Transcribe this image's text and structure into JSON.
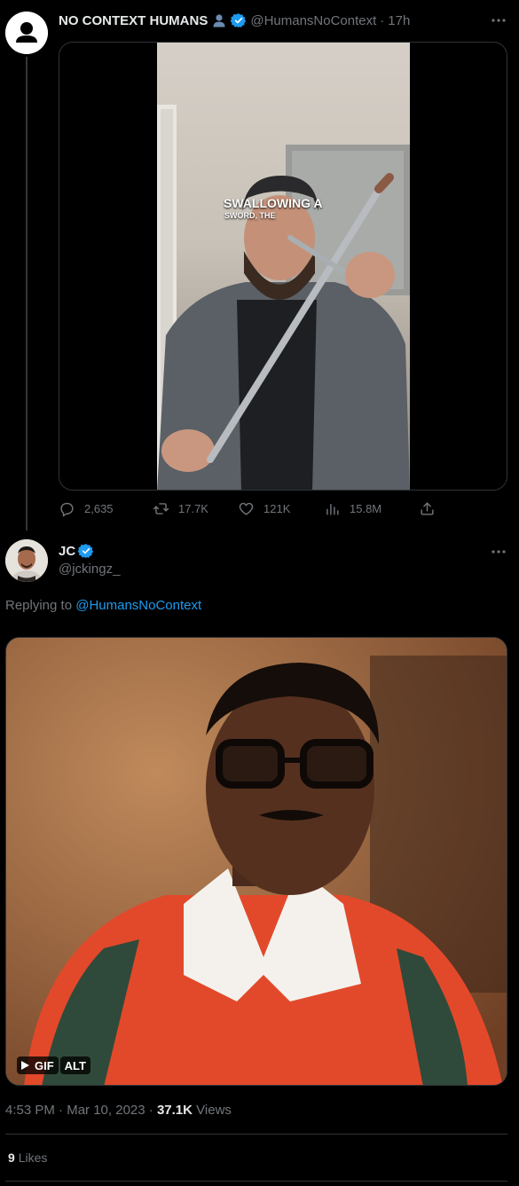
{
  "original_tweet": {
    "author_name": "NO CONTEXT HUMANS",
    "handle": "@HumansNoContext",
    "time": "17h",
    "media_caption_line1": "SWALLOWING A",
    "media_caption_line2": "SWORD, THE",
    "stats": {
      "replies": "2,635",
      "retweets": "17.7K",
      "likes": "121K",
      "views": "15.8M"
    }
  },
  "reply": {
    "author_name": "JC",
    "handle": "@jckingz_",
    "replying_label": "Replying to",
    "replying_to": "@HumansNoContext",
    "gif_label": "GIF",
    "alt_label": "ALT",
    "time": "4:53 PM",
    "date": "Mar 10, 2023",
    "views_count": "37.1K",
    "views_label": "Views",
    "likes_count": "9",
    "likes_label": "Likes"
  },
  "icons": {
    "more": "more-dots-icon",
    "verified": "verified-badge-icon",
    "person": "person-emoji-icon",
    "reply": "reply-icon",
    "retweet": "retweet-icon",
    "like": "heart-icon",
    "views": "views-icon",
    "share": "share-icon",
    "play": "play-icon"
  },
  "colors": {
    "background": "#000000",
    "text": "#e7e9ea",
    "muted": "#71767b",
    "accent": "#1d9bf0",
    "border": "#2f3336"
  }
}
